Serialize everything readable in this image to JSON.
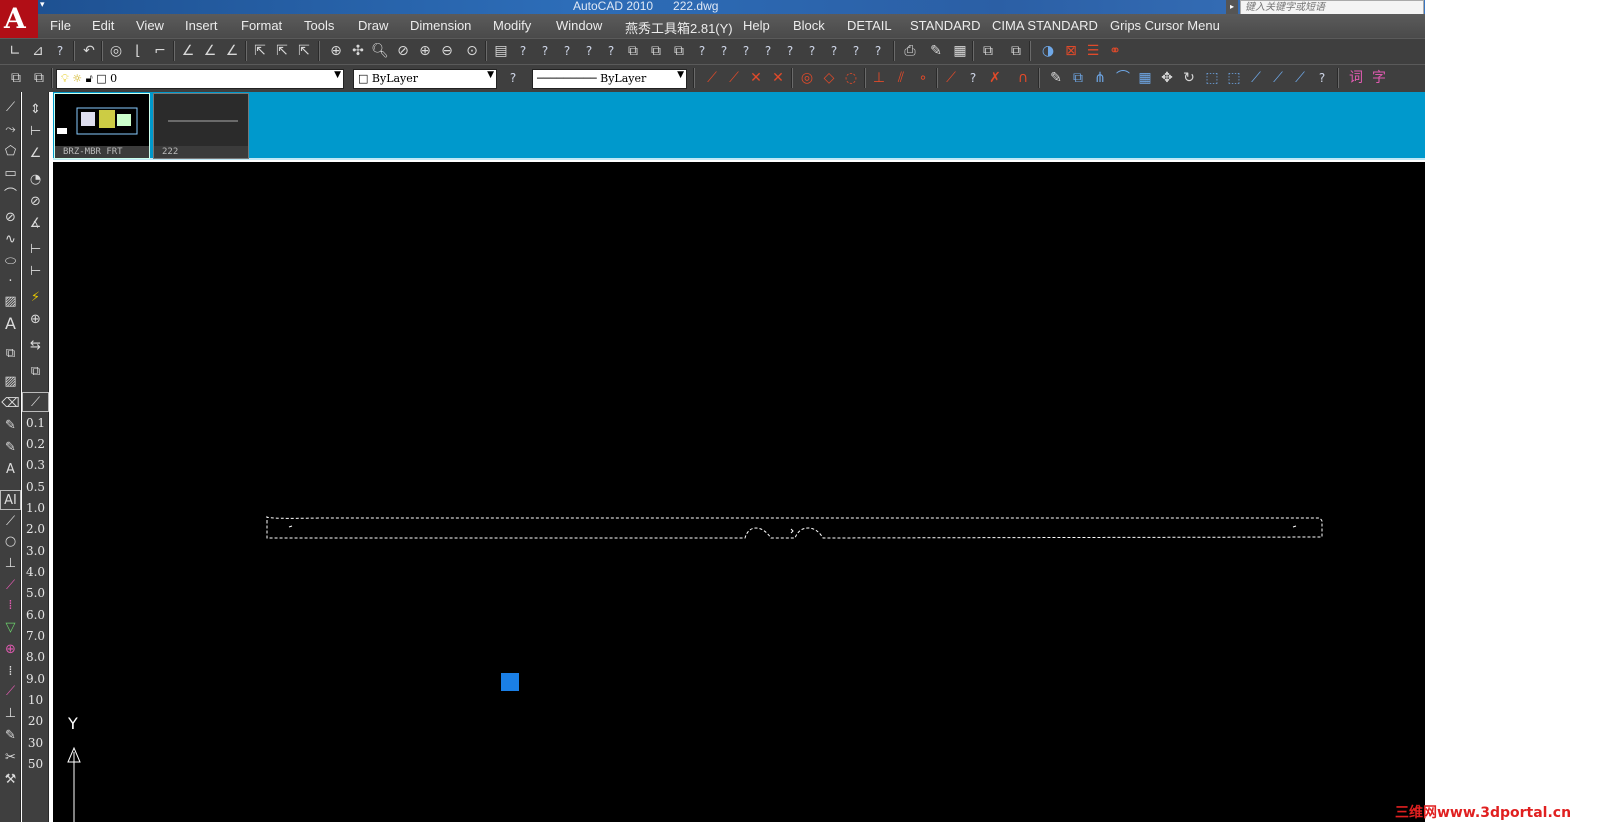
{
  "window": {
    "title": "AutoCAD 2010      222.dwg",
    "search_placeholder": "键入关键字或短语"
  },
  "menubar": {
    "items": [
      "File",
      "Edit",
      "View",
      "Insert",
      "Format",
      "Tools",
      "Draw",
      "Dimension",
      "Modify",
      "Window",
      "燕秀工具箱2.81(Y)",
      "Help",
      "Block",
      "DETAIL",
      "STANDARD",
      "CIMA STANDARD",
      "Grips Cursor Menu"
    ]
  },
  "layer_toolbar": {
    "layer_value": "0",
    "color_value": "ByLayer",
    "linetype_value": "ByLayer"
  },
  "scale_list": [
    "0.1",
    "0.2",
    "0.3",
    "0.5",
    "1.0",
    "2.0",
    "3.0",
    "4.0",
    "5.0",
    "6.0",
    "7.0",
    "8.0",
    "9.0",
    "10",
    "20",
    "30",
    "50"
  ],
  "file_tabs": [
    {
      "label": "BRZ-MBR FRT",
      "active": true
    },
    {
      "label": "222",
      "active": false
    }
  ],
  "ucs": {
    "y_label": "Y"
  },
  "watermark": "三维网www.3dportal.cn",
  "colors": {
    "canvas": "#000000",
    "tab_strip": "#0099cc",
    "selection_grip": "#1a7fe6",
    "menubar": "#4f4f4f"
  }
}
